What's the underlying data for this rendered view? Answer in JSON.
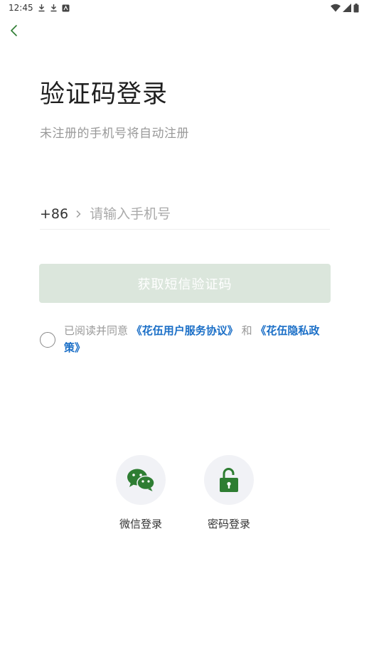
{
  "status_bar": {
    "time": "12:45"
  },
  "header": {
    "back_icon": "chevron-left-icon"
  },
  "page": {
    "title": "验证码登录",
    "subtitle": "未注册的手机号将自动注册"
  },
  "phone": {
    "country_code": "+86",
    "placeholder": "请输入手机号",
    "value": ""
  },
  "sms_button": {
    "label": "获取短信验证码"
  },
  "agreement": {
    "prefix": "已阅读并同意 ",
    "service_link": "《花伍用户服务协议》",
    "and": " 和 ",
    "privacy_link": "《花伍隐私政策》"
  },
  "alt_logins": [
    {
      "label": "微信登录",
      "icon": "wechat-icon"
    },
    {
      "label": "密码登录",
      "icon": "unlock-icon"
    }
  ],
  "colors": {
    "accent": "#2e7d32",
    "button_disabled": "#dbe6dc",
    "link": "#1b6fc7"
  }
}
